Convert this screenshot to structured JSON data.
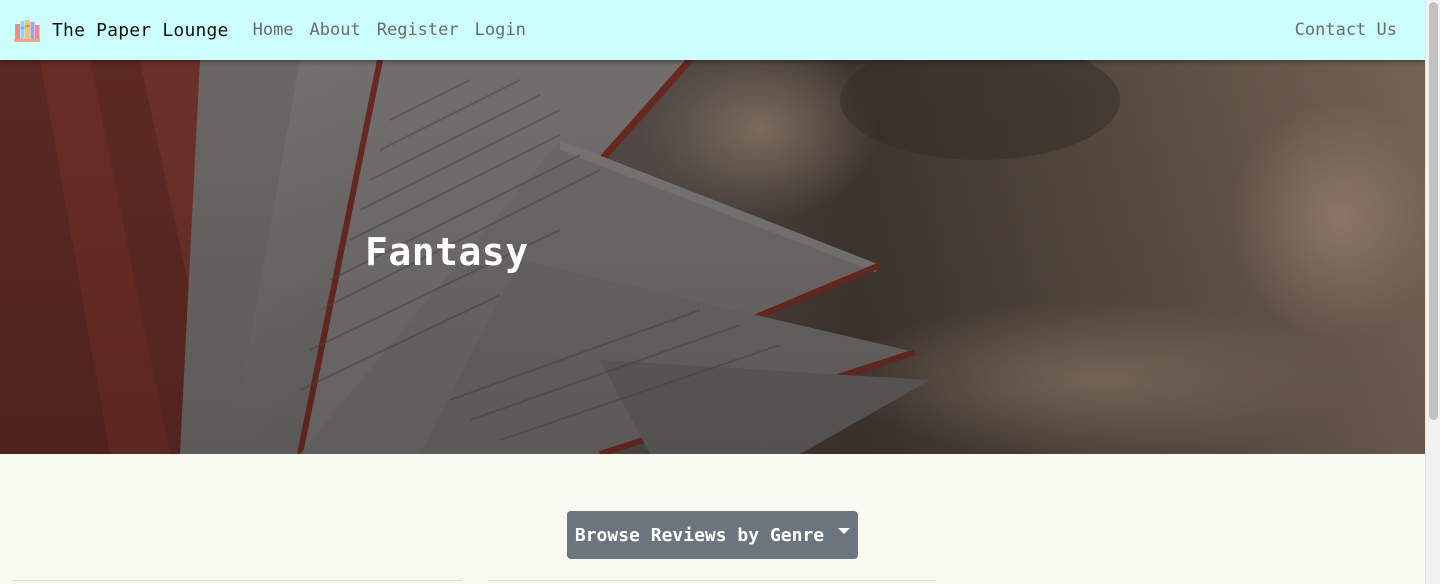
{
  "navbar": {
    "brand": "The Paper Lounge",
    "links": [
      "Home",
      "About",
      "Register",
      "Login"
    ],
    "right_link": "Contact Us",
    "background": "#ccfffb"
  },
  "hero": {
    "title": "Fantasy",
    "image": "open-book-pages-photo"
  },
  "main": {
    "dropdown_label": "Browse Reviews by Genre",
    "dropdown_color": "#6c757d"
  }
}
